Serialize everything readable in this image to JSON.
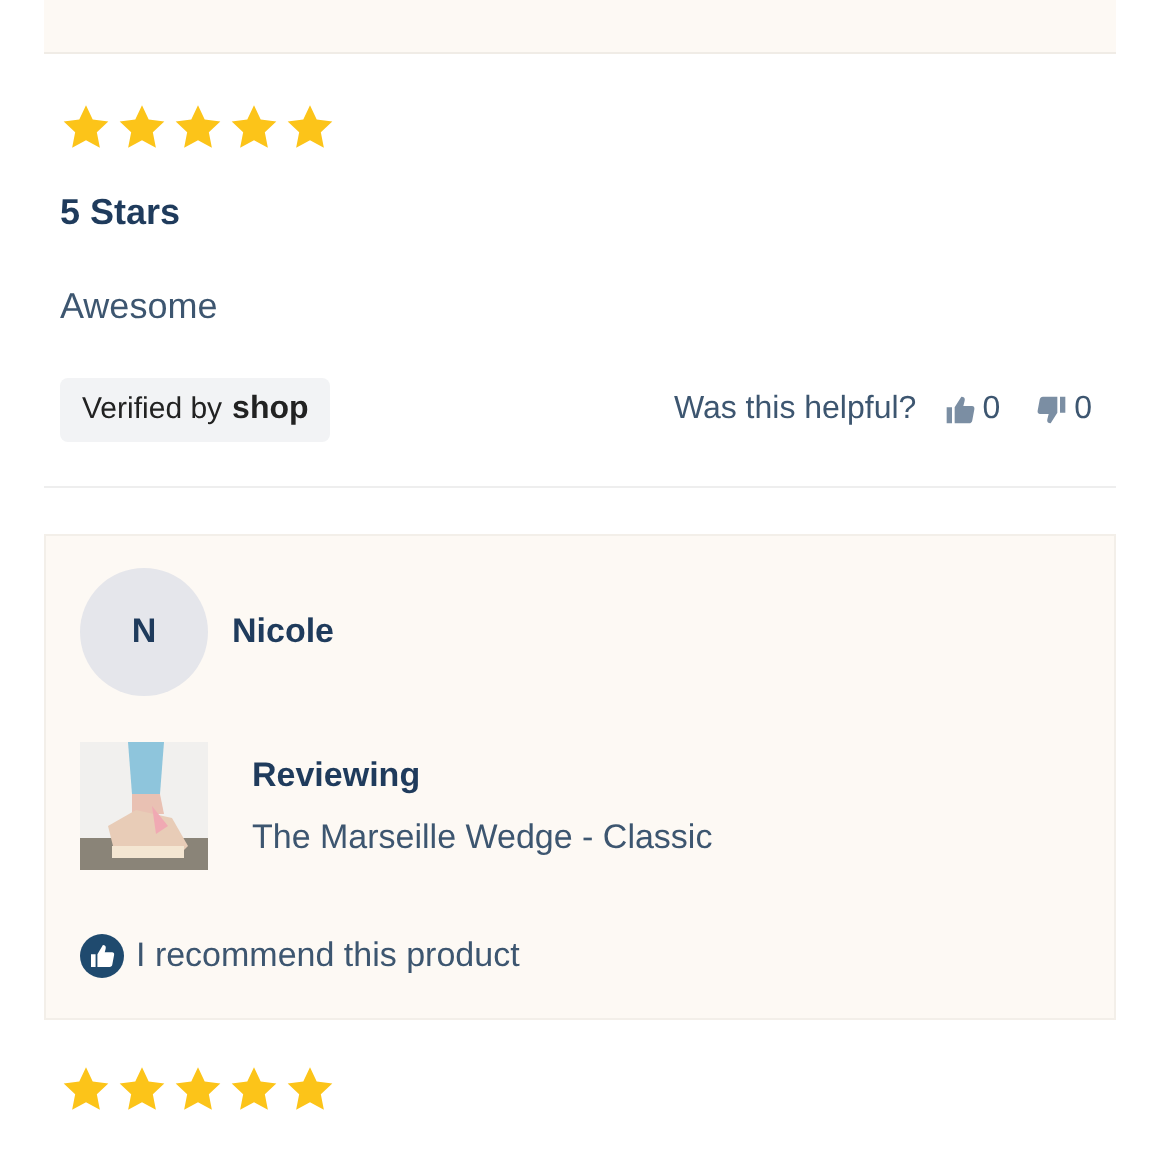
{
  "review_1": {
    "stars": 5,
    "title": "5 Stars",
    "body": "Awesome",
    "verified_label": "Verified by",
    "verified_brand": "shop",
    "helpful_prompt": "Was this helpful?",
    "upvotes": "0",
    "downvotes": "0"
  },
  "reviewer_card": {
    "initial": "N",
    "name": "Nicole",
    "reviewing_label": "Reviewing",
    "product": "The Marseille Wedge - Classic",
    "recommend": "I recommend this product"
  },
  "review_2": {
    "stars": 5
  }
}
